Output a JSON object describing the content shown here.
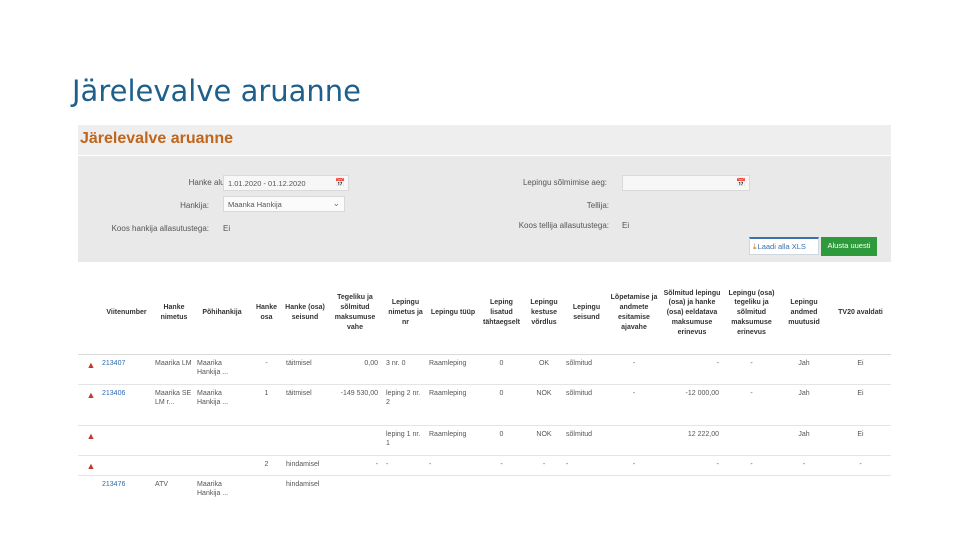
{
  "slide": {
    "title": "Järelevalve aruanne"
  },
  "report": {
    "title": "Järelevalve aruanne",
    "filters": {
      "start_label": "Hanke alustamise aeg:",
      "start_value": "1.01.2020 - 01.12.2020",
      "contract_date_label": "Lepingu sõlmimise aeg:",
      "contract_date_value": "",
      "supplier_label": "Hankija:",
      "supplier_value": "Maanka Hankija",
      "customer_label": "Tellija:",
      "customer_value": "",
      "cooperation_supplier_label": "Koos hankija allasutustega:",
      "cooperation_supplier_value": "Ei",
      "cooperation_customer_label": "Koos tellija allasutustega:",
      "cooperation_customer_value": "Ei"
    },
    "buttons": {
      "xls": "Laadi alla XLS",
      "reset": "Alusta uuesti"
    },
    "icons": {
      "calendar": "calendar-icon",
      "chevron": "chevron-down-icon",
      "download": "download-icon",
      "warning": "warning-icon"
    },
    "table": {
      "headers": [
        "",
        "Viitenumber",
        "Hanke nimetus",
        "Põhihankija",
        "Hanke osa",
        "Hanke (osa) seisund",
        "Tegeliku ja sõlmitud maksumuse vahe",
        "Lepingu nimetus ja nr",
        "Lepingu tüüp",
        "Leping lisatud tähtaegselt",
        "Lepingu kestuse võrdlus",
        "Lepingu seisund",
        "Lõpetamise ja andmete esitamise ajavahe",
        "Sõlmitud lepingu (osa) ja hanke (osa) eeldatava maksumuse erinevus",
        "Lepingu (osa) tegeliku ja sõlmitud maksumuse erinevus",
        "Lepingu andmed muutusid",
        "TV20 avaldati"
      ],
      "rows": [
        [
          "warn",
          "213407",
          "Maarika LM",
          "Maarika Hankija ...",
          "-",
          "täitmisel",
          "0,00",
          "3 nr. 0",
          "Raamleping",
          "0",
          "OK",
          "sõlmitud",
          "-",
          "-",
          "-",
          "Jah",
          "Ei"
        ],
        [
          "warn",
          "213406",
          "Maarika SE LM r...",
          "Maarika Hankija ...",
          "1",
          "täitmisel",
          "-149 530,00",
          "leping 2 nr. 2",
          "Raamleping",
          "0",
          "NOK",
          "sõlmitud",
          "-",
          "-12 000,00",
          "-",
          "Jah",
          "Ei"
        ],
        [
          "warn",
          "",
          "",
          "",
          "",
          "",
          "",
          "leping 1 nr. 1",
          "Raamleping",
          "0",
          "NOK",
          "sõlmitud",
          "",
          "12 222,00",
          "",
          "Jah",
          "Ei"
        ],
        [
          "warn",
          "",
          "",
          "",
          "2",
          "hindamisel",
          "-",
          "-",
          "-",
          "-",
          "-",
          "-",
          "-",
          "-",
          "-",
          "-",
          "-"
        ],
        [
          "",
          "213476",
          "ATV",
          "Maarika Hankija ...",
          "",
          "hindamisel",
          "",
          "",
          "",
          "",
          "",
          "",
          "",
          "",
          "",
          "",
          ""
        ]
      ]
    }
  }
}
